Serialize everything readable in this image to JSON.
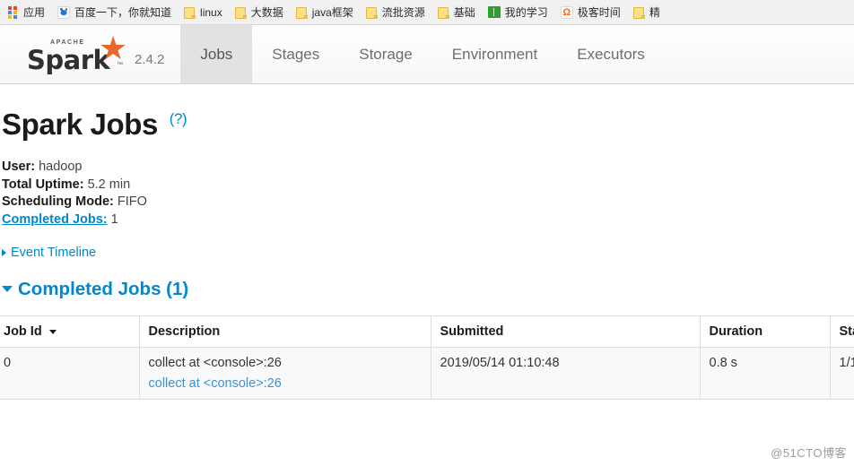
{
  "browser": {
    "bookmarks": [
      {
        "label": "应用",
        "icon": "apps-grid-icon"
      },
      {
        "label": "百度一下，你就知道",
        "icon": "baidu-icon"
      },
      {
        "label": "linux",
        "icon": "folder-icon"
      },
      {
        "label": "大数据",
        "icon": "folder-icon"
      },
      {
        "label": "java框架",
        "icon": "folder-icon"
      },
      {
        "label": "流批资源",
        "icon": "folder-icon"
      },
      {
        "label": "基础",
        "icon": "folder-icon"
      },
      {
        "label": "我的学习",
        "icon": "book-icon"
      },
      {
        "label": "极客时间",
        "icon": "geek-icon"
      },
      {
        "label": "精",
        "icon": "folder-icon"
      }
    ]
  },
  "navbar": {
    "brand": {
      "apache_text": "APACHE",
      "spark_text": "Spark",
      "trademark": "™",
      "star_glyph": "★"
    },
    "version": "2.4.2",
    "tabs": [
      {
        "label": "Jobs",
        "active": true
      },
      {
        "label": "Stages",
        "active": false
      },
      {
        "label": "Storage",
        "active": false
      },
      {
        "label": "Environment",
        "active": false
      },
      {
        "label": "Executors",
        "active": false
      }
    ]
  },
  "page": {
    "title": "Spark Jobs",
    "help_label": "(?)",
    "summary": {
      "user_label": "User:",
      "user_value": "hadoop",
      "uptime_label": "Total Uptime:",
      "uptime_value": "5.2 min",
      "scheduling_label": "Scheduling Mode:",
      "scheduling_value": "FIFO",
      "completed_label": "Completed Jobs:",
      "completed_value": "1"
    },
    "event_timeline_label": "Event Timeline",
    "completed_jobs_heading": "Completed Jobs (1)"
  },
  "jobs_table": {
    "columns": [
      {
        "key": "job_id",
        "label": "Job Id",
        "sorted": true
      },
      {
        "key": "description",
        "label": "Description",
        "sorted": false
      },
      {
        "key": "submitted",
        "label": "Submitted",
        "sorted": false
      },
      {
        "key": "duration",
        "label": "Duration",
        "sorted": false
      },
      {
        "key": "stages",
        "label": "Sta",
        "sorted": false
      }
    ],
    "rows": [
      {
        "job_id": "0",
        "description_main": "collect at <console>:26",
        "description_link": "collect at <console>:26",
        "submitted": "2019/05/14 01:10:48",
        "duration": "0.8 s",
        "stages": "1/1"
      }
    ]
  },
  "watermark": "@51CTO博客",
  "colors": {
    "link": "#0088cc",
    "spark_orange": "#e8682c",
    "active_tab_bg": "#e2e2e2",
    "row_bg": "#f9f9f9",
    "border": "#dddddd"
  }
}
